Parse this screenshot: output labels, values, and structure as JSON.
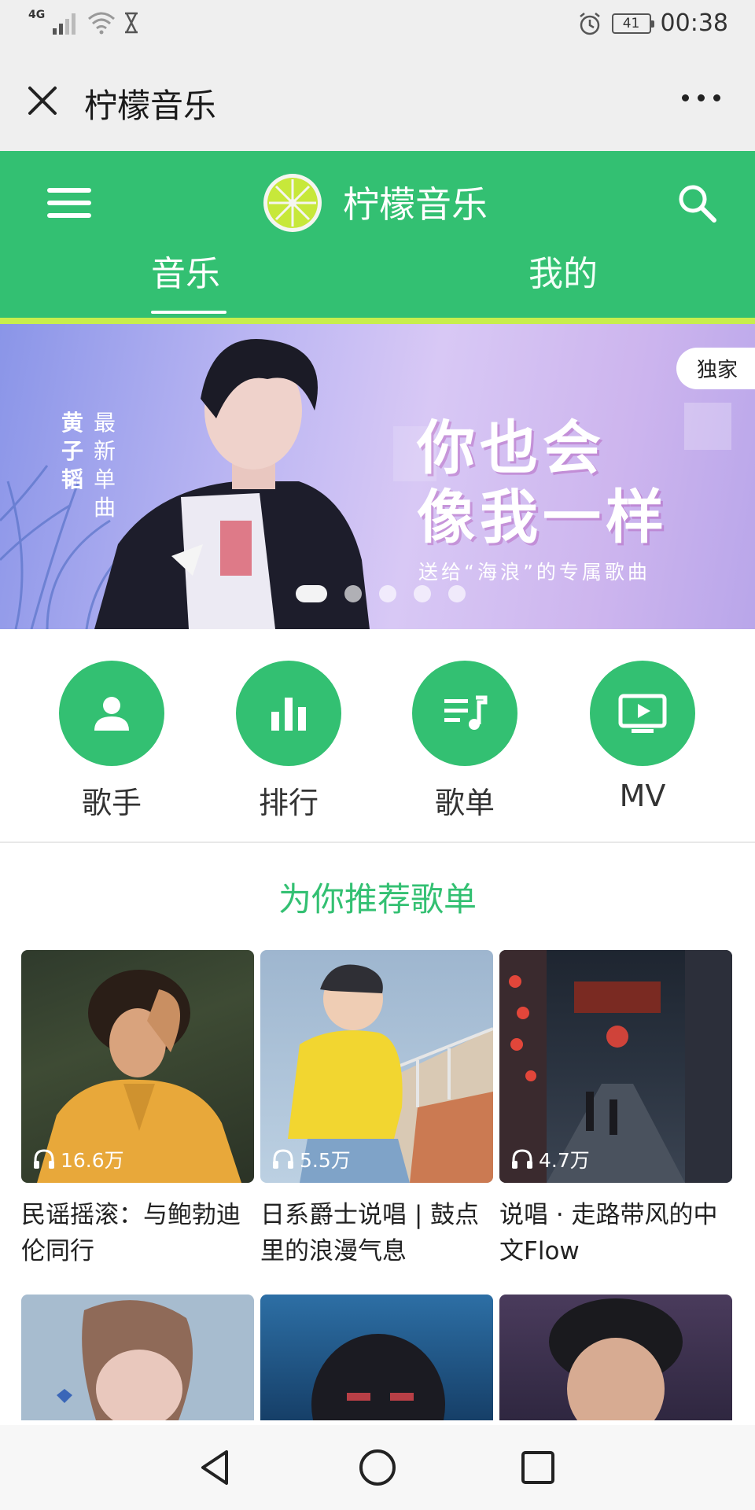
{
  "status_bar": {
    "network": "4G",
    "battery": "41",
    "time": "00:38",
    "icons": [
      "signal-icon",
      "wifi-icon",
      "hourglass-icon",
      "alarm-icon",
      "battery-icon"
    ]
  },
  "titlebar": {
    "title": "柠檬音乐",
    "icons": [
      "close-icon",
      "more-icon"
    ]
  },
  "header": {
    "brand": "柠檬音乐",
    "tabs": [
      "音乐",
      "我的"
    ],
    "active_tab": "音乐",
    "colors": {
      "primary": "#33c072",
      "accent_line": "#c8ee4c"
    },
    "icons": [
      "menu-icon",
      "lemon-logo-icon",
      "search-icon"
    ]
  },
  "banner": {
    "badge": "独家",
    "side_text_a": "黄子韬",
    "side_text_b": "最新单曲",
    "headline_1": "你也会",
    "headline_2": "像我一样",
    "subline": "送给“海浪”的专属歌曲",
    "slide_count": 5,
    "active_slide": 1
  },
  "categories": [
    {
      "label": "歌手",
      "icon": "person-icon"
    },
    {
      "label": "排行",
      "icon": "bar-chart-icon"
    },
    {
      "label": "歌单",
      "icon": "playlist-icon"
    },
    {
      "label": "MV",
      "icon": "tv-play-icon"
    }
  ],
  "recommend": {
    "title": "为你推荐歌单",
    "cards": [
      {
        "plays": "16.6万",
        "title": "民谣摇滚：与鲍勃迪伦同行"
      },
      {
        "plays": "5.5万",
        "title": "日系爵士说唱 | 鼓点里的浪漫气息"
      },
      {
        "plays": "4.7万",
        "title": "说唱 · 走路带风的中文Flow"
      }
    ]
  },
  "navbar": {
    "icons": [
      "back-triangle-icon",
      "home-circle-icon",
      "recents-square-icon"
    ]
  }
}
